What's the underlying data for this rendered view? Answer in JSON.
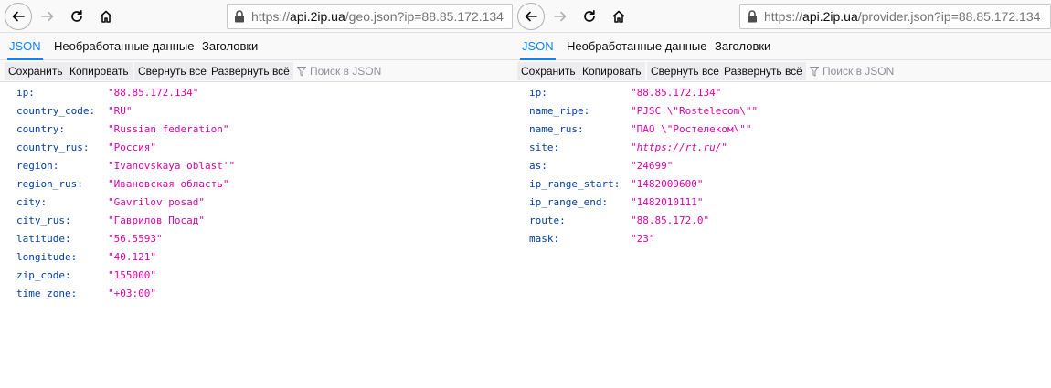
{
  "left": {
    "url": {
      "proto": "https://",
      "host": "api.2ip.ua",
      "path": "/geo.json?ip=88.85.172.134"
    },
    "tabs": [
      "JSON",
      "Необработанные данные",
      "Заголовки"
    ],
    "toolbar": {
      "save": "Сохранить",
      "copy": "Копировать",
      "collapse": "Свернуть все",
      "expand": "Развернуть всё",
      "filter_placeholder": "Поиск в JSON"
    },
    "rows": [
      {
        "key": "ip:",
        "value": "\"88.85.172.134\""
      },
      {
        "key": "country_code:",
        "value": "\"RU\""
      },
      {
        "key": "country:",
        "value": "\"Russian federation\""
      },
      {
        "key": "country_rus:",
        "value": "\"Россия\""
      },
      {
        "key": "region:",
        "value": "\"Ivanovskaya oblast'\""
      },
      {
        "key": "region_rus:",
        "value": "\"Ивановская область\""
      },
      {
        "key": "city:",
        "value": "\"Gavrilov posad\""
      },
      {
        "key": "city_rus:",
        "value": "\"Гаврилов Посад\""
      },
      {
        "key": "latitude:",
        "value": "\"56.5593\""
      },
      {
        "key": "longitude:",
        "value": "\"40.121\""
      },
      {
        "key": "zip_code:",
        "value": "\"155000\""
      },
      {
        "key": "time_zone:",
        "value": "\"+03:00\""
      }
    ]
  },
  "right": {
    "url": {
      "proto": "https://",
      "host": "api.2ip.ua",
      "path": "/provider.json?ip=88.85.172.134"
    },
    "tabs": [
      "JSON",
      "Необработанные данные",
      "Заголовки"
    ],
    "toolbar": {
      "save": "Сохранить",
      "copy": "Копировать",
      "collapse": "Свернуть все",
      "expand": "Развернуть всё",
      "filter_placeholder": "Поиск в JSON"
    },
    "rows": [
      {
        "key": "ip:",
        "value": "\"88.85.172.134\""
      },
      {
        "key": "name_ripe:",
        "value": "\"PJSC \\\"Rostelecom\\\"\""
      },
      {
        "key": "name_rus:",
        "value": "\"ПАО \\\"Ростелеком\\\"\""
      },
      {
        "key": "site:",
        "value": "\"https://rt.ru/\""
      },
      {
        "key": "as:",
        "value": "\"24699\""
      },
      {
        "key": "ip_range_start:",
        "value": "\"1482009600\""
      },
      {
        "key": "ip_range_end:",
        "value": "\"1482010111\""
      },
      {
        "key": "route:",
        "value": "\"88.85.172.0\""
      },
      {
        "key": "mask:",
        "value": "\"23\""
      }
    ]
  },
  "icons": {
    "back": "back-arrow-icon",
    "forward": "forward-arrow-icon",
    "reload": "reload-icon",
    "home": "home-icon",
    "lock": "lock-icon",
    "filter": "filter-icon"
  },
  "colors": {
    "accent": "#0a84ff",
    "json_key": "#003eaa",
    "json_string": "#dd00a9"
  }
}
